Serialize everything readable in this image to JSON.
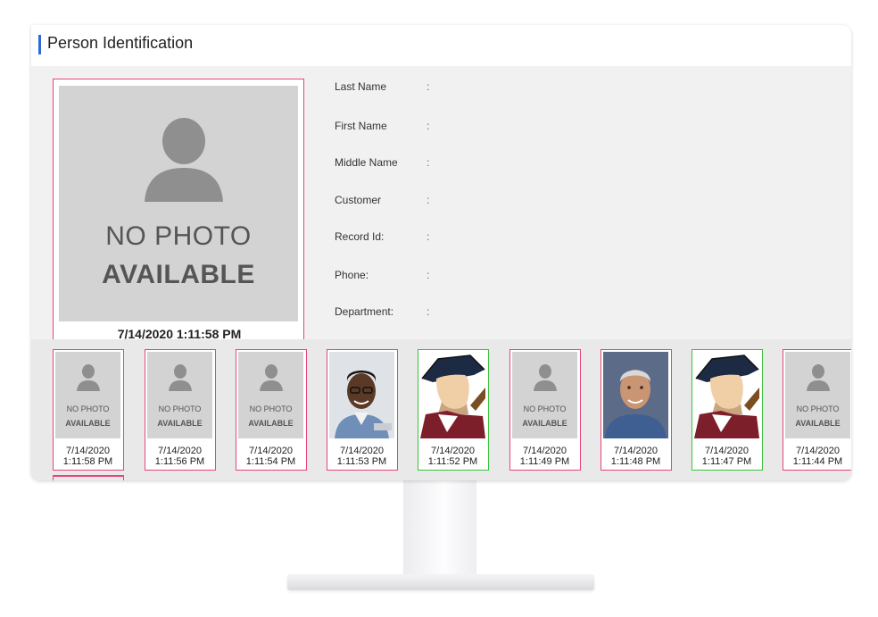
{
  "header": {
    "title": "Person Identification"
  },
  "main_photo": {
    "placeholder_line1": "NO PHOTO",
    "placeholder_line2": "AVAILABLE",
    "timestamp": "7/14/2020 1:11:58 PM"
  },
  "fields": [
    {
      "label": "Last Name",
      "value": ":"
    },
    {
      "label": "First Name",
      "value": ":"
    },
    {
      "label": "Middle Name",
      "value": ":"
    },
    {
      "label": "Customer",
      "value": ":"
    },
    {
      "label": "Record Id:",
      "value": ":"
    },
    {
      "label": "Phone:",
      "value": ":"
    },
    {
      "label": "Department:",
      "value": ":"
    }
  ],
  "thumbnails": [
    {
      "kind": "no-photo",
      "border": "red",
      "np1": "NO PHOTO",
      "np2": "AVAILABLE",
      "date": "7/14/2020",
      "time": "1:11:58 PM"
    },
    {
      "kind": "no-photo",
      "border": "red",
      "np1": "NO PHOTO",
      "np2": "AVAILABLE",
      "date": "7/14/2020",
      "time": "1:11:56 PM"
    },
    {
      "kind": "no-photo",
      "border": "red",
      "np1": "NO PHOTO",
      "np2": "AVAILABLE",
      "date": "7/14/2020",
      "time": "1:11:54 PM"
    },
    {
      "kind": "person-young",
      "border": "red",
      "date": "7/14/2020",
      "time": "1:11:53 PM"
    },
    {
      "kind": "mascot",
      "border": "green",
      "date": "7/14/2020",
      "time": "1:11:52 PM"
    },
    {
      "kind": "no-photo",
      "border": "red",
      "np1": "NO PHOTO",
      "np2": "AVAILABLE",
      "date": "7/14/2020",
      "time": "1:11:49 PM"
    },
    {
      "kind": "person-older",
      "border": "red",
      "date": "7/14/2020",
      "time": "1:11:48 PM"
    },
    {
      "kind": "mascot",
      "border": "green",
      "date": "7/14/2020",
      "time": "1:11:47 PM"
    },
    {
      "kind": "no-photo",
      "border": "red",
      "np1": "NO PHOTO",
      "np2": "AVAILABLE",
      "date": "7/14/2020",
      "time": "1:11:44 PM"
    }
  ],
  "colors": {
    "accent": "#2c6bd6",
    "unmatched_border": "#e8457a",
    "matched_border": "#3cc03c"
  }
}
